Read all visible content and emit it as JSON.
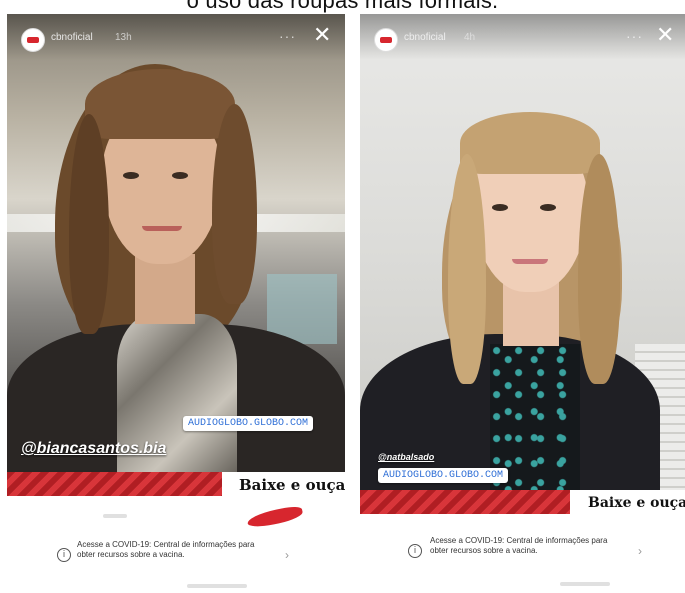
{
  "caption": "o uso das roupas mais formais.",
  "stories": [
    {
      "username": "cbnoficial",
      "time_ago": "13h",
      "more_label": "···",
      "close_label": "✕",
      "link_sticker": "AUDIOGLOBO.GLOBO.COM",
      "mention": "@biancasantos.bia",
      "promo_text": "Baixe e ouça.",
      "covid_text": "Acesse a COVID-19: Central de informações para obter recursos sobre a vacina.",
      "info_icon": "i",
      "chevron": "›"
    },
    {
      "username": "cbnoficial",
      "time_ago": "4h",
      "more_label": "···",
      "close_label": "✕",
      "link_sticker": "AUDIOGLOBO.GLOBO.COM",
      "mention": "@natbalsado",
      "promo_text": "Baixe e ouça.",
      "covid_text": "Acesse a COVID-19: Central de informações para obter recursos sobre a vacina.",
      "info_icon": "i",
      "chevron": "›"
    }
  ],
  "colors": {
    "brand_red": "#d7262e",
    "link_blue": "#2f6fd6"
  },
  "icons": [
    "avatar",
    "more-icon",
    "close-icon",
    "info-icon",
    "chevron-right-icon"
  ]
}
